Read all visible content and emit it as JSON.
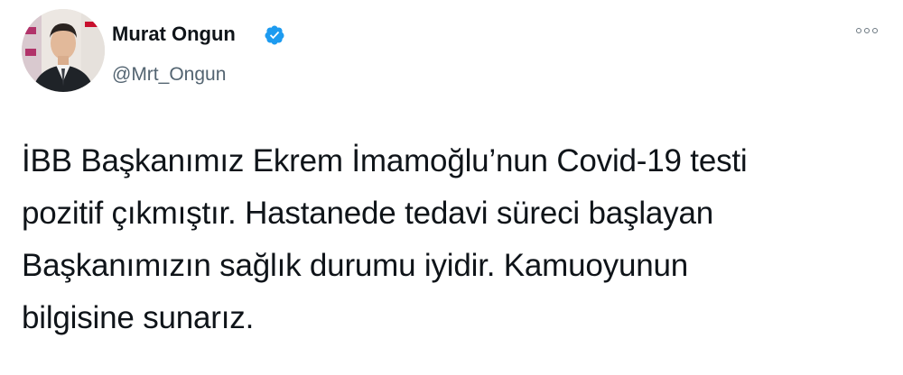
{
  "author": {
    "name": "Murat Ongun",
    "handle": "@Mrt_Ongun",
    "verified": true,
    "verified_icon": "verified-badge-icon",
    "verified_color": "#1d9bf0"
  },
  "menu": {
    "icon": "more-options-icon"
  },
  "tweet": {
    "lines": [
      "İBB Başkanımız Ekrem İmamoğlu’nun Covid-19 testi",
      "pozitif çıkmıştır. Hastanede tedavi süreci başlayan",
      "Başkanımızın sağlık durumu iyidir. Kamuoyunun",
      "bilgisine sunarız."
    ]
  },
  "colors": {
    "text": "#0f1419",
    "secondary": "#536471",
    "accent": "#1d9bf0"
  }
}
